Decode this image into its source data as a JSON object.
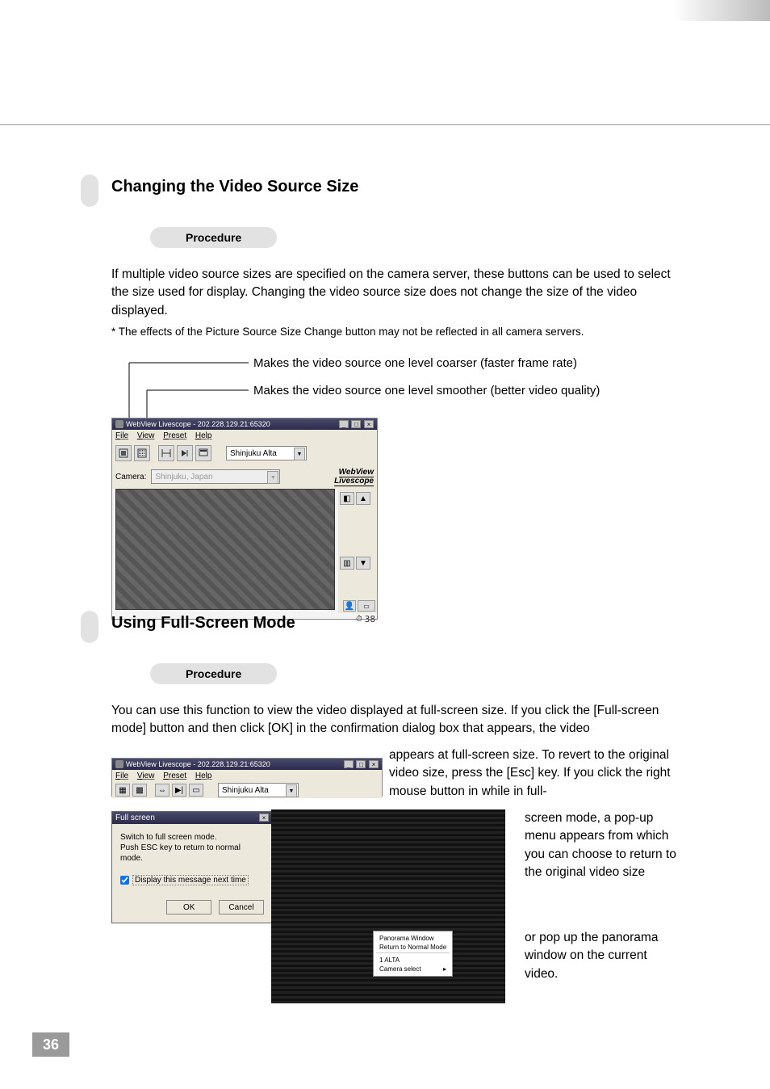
{
  "heading1": "Changing the Video Source Size",
  "heading2": "Using Full-Screen Mode",
  "procedure_label": "Procedure",
  "para1": "If multiple video source sizes are specified on the camera server, these buttons can be used to select the size used for display. Changing the video source size does not change the size of the video displayed.",
  "note1": "* The effects of the Picture Source Size Change button may not be reflected in all camera servers.",
  "callout_coarser": "Makes the video source one level coarser (faster frame rate)",
  "callout_smoother": "Makes the video source one level smoother (better video quality)",
  "para2": "You can use this function to view the video displayed at full-screen size. If you click the [Full-screen mode] button and then click [OK] in the confirmation dialog box that appears, the video",
  "para2b": "appears at full-screen size. To revert to the original video size, press the [Esc] key. If you click the right mouse button in while in full-",
  "para2c": "screen mode, a pop-up menu appears from which you can choose to return to the original video size",
  "para2d": "or pop up the panorama window on the current video.",
  "app": {
    "title": "WebView Livescope - 202.228.129.21:65320",
    "menu": {
      "file": "File",
      "view": "View",
      "preset": "Preset",
      "help": "Help"
    },
    "preset_value": "Shinjuku Alta",
    "camera_label": "Camera:",
    "camera_value": "Shinjuku, Japan",
    "logo1": "WebView",
    "logo2": "Livescope",
    "timer": "38"
  },
  "dialog": {
    "title": "Full screen",
    "msg1": "Switch to full screen mode.",
    "msg2": "Push ESC key to return to normal mode.",
    "checkbox": "Display this message next time",
    "ok": "OK",
    "cancel": "Cancel"
  },
  "context_menu": {
    "item1": "Panorama Window",
    "item2": "Return to Normal Mode",
    "item3": "1 ALTA",
    "item4": "Camera select"
  },
  "page_number": "36"
}
